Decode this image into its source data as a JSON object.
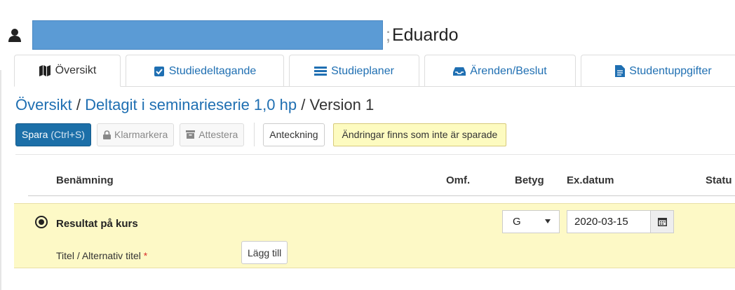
{
  "header": {
    "name_suffix": "Eduardo"
  },
  "tabs": [
    {
      "label": "Översikt",
      "icon": "map-icon",
      "active": true
    },
    {
      "label": "Studiedeltagande",
      "icon": "checkbox-icon"
    },
    {
      "label": "Studieplaner",
      "icon": "list-icon"
    },
    {
      "label": "Ärenden/Beslut",
      "icon": "inbox-icon"
    },
    {
      "label": "Studentuppgifter",
      "icon": "document-icon"
    }
  ],
  "breadcrumb": {
    "root": "Översikt",
    "separator": "/",
    "course": "Deltagit i seminarieserie 1,0 hp",
    "current": "Version 1"
  },
  "toolbar": {
    "save_label": "Spara",
    "save_hint": "(Ctrl+S)",
    "mark_done_label": "Klarmarkera",
    "attest_label": "Attestera",
    "note_label": "Anteckning",
    "unsaved_notice": "Ändringar finns som inte är sparade"
  },
  "table": {
    "columns": {
      "name": "Benämning",
      "scope": "Omf.",
      "grade": "Betyg",
      "exam_date": "Ex.datum",
      "status": "Statu"
    },
    "rows": [
      {
        "title": "Resultat på kurs",
        "subtitle": "Titel / Alternativ titel",
        "required_mark": "*",
        "add_label": "Lägg till",
        "grade": "G",
        "exam_date": "2020-03-15"
      }
    ]
  },
  "colors": {
    "accent": "#1f6fb2",
    "primary_button": "#1c6fa8",
    "notice_bg": "#fdfbc0",
    "row_highlight": "#fdf9c6",
    "redaction": "#5b9bd5"
  }
}
